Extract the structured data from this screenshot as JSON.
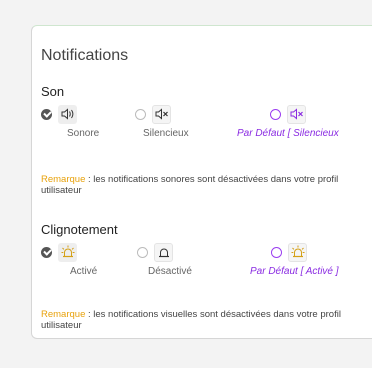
{
  "title": "Notifications",
  "son": {
    "heading": "Son",
    "options": [
      {
        "label": "Sonore",
        "selected": true
      },
      {
        "label": "Silencieux",
        "selected": false
      },
      {
        "label": "Par Défaut [ Silencieux",
        "selected": false
      }
    ],
    "note_label": "Remarque",
    "note_text": " : les notifications sonores sont désactivées dans votre profil utilisateur"
  },
  "clignotement": {
    "heading": "Clignotement",
    "options": [
      {
        "label": "Activé",
        "selected": true
      },
      {
        "label": "Désactivé",
        "selected": false
      },
      {
        "label": "Par Défaut [ Activé ]",
        "selected": false
      }
    ],
    "note_label": "Remarque",
    "note_text": " : les notifications visuelles sont désactivées dans votre profil utilisateur"
  },
  "colors": {
    "accent_purple": "#8a2be2",
    "remark_orange": "#e8a20c"
  }
}
